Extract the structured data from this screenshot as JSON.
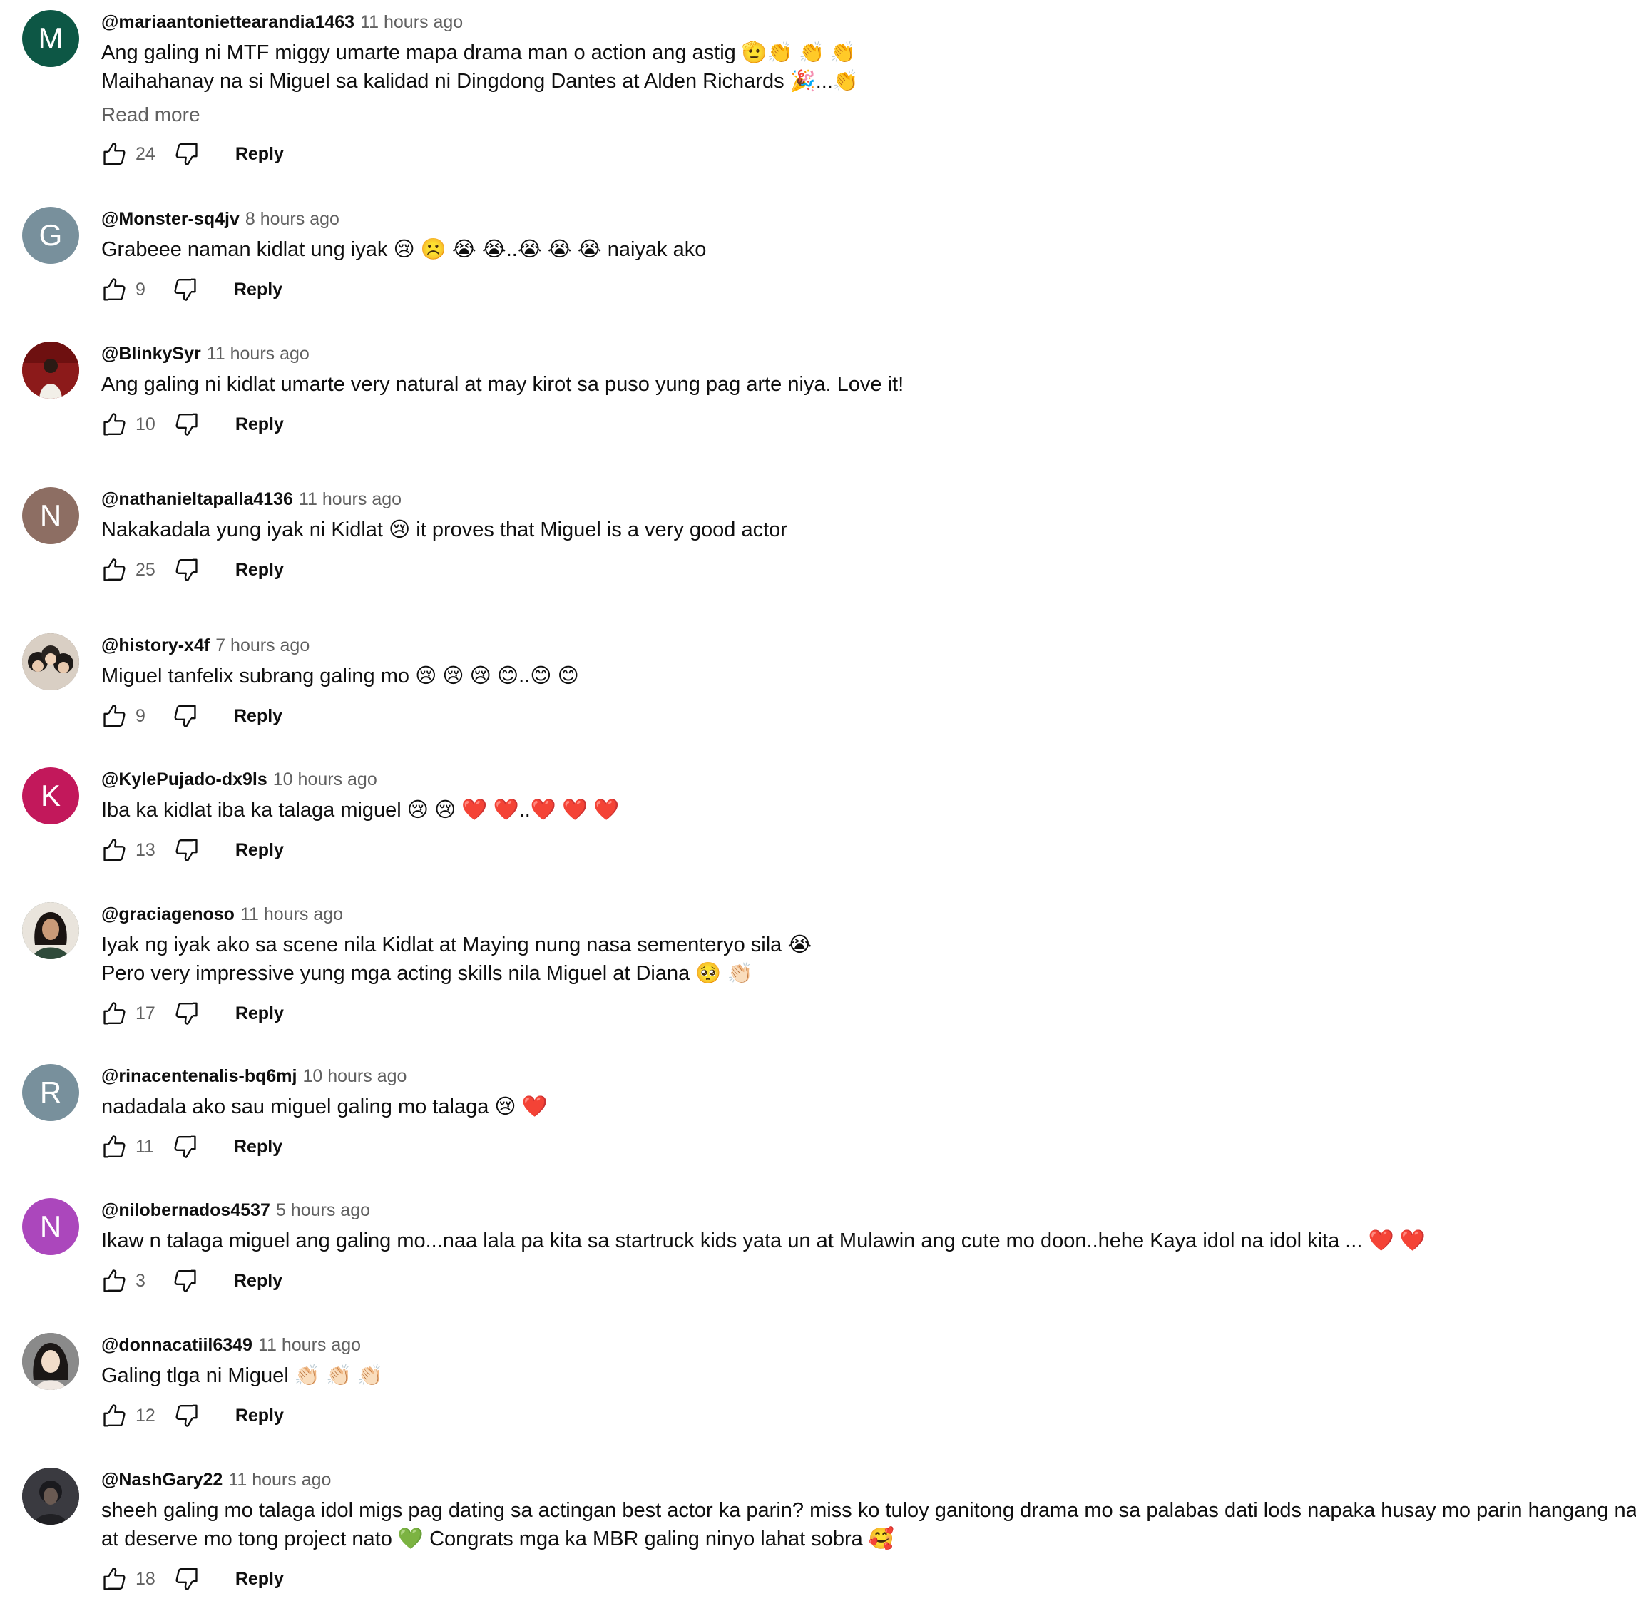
{
  "comments": [
    {
      "author": "@mariaantoniettearandia1463",
      "time": "11 hours ago",
      "lines": [
        "Ang galing ni MTF  miggy umarte mapa drama man o action ang astig 🫡👏 👏 👏",
        "Maihahanay na si Miguel sa kalidad ni Dingdong Dantes at Alden Richards 🎉...👏"
      ],
      "read_more": "Read more",
      "likes": "24",
      "reply": "Reply",
      "avatar": {
        "letter": "M",
        "color": "#0d5745"
      }
    },
    {
      "author": "@Monster-sq4jv",
      "time": "8 hours ago",
      "lines": [
        "Grabeee naman kidlat ung iyak 😢 ☹️ 😭 😭..😭 😭 😭 naiyak ako"
      ],
      "likes": "9",
      "reply": "Reply",
      "avatar": {
        "letter": "G",
        "color": "#78909c"
      }
    },
    {
      "author": "@BlinkySyr",
      "time": "11 hours ago",
      "lines": [
        "Ang galing ni kidlat umarte very natural at may kirot sa puso yung pag arte niya. Love it!"
      ],
      "likes": "10",
      "reply": "Reply",
      "avatar": {
        "letter": "",
        "color": "#8c1a1a"
      }
    },
    {
      "author": "@nathanieltapalla4136",
      "time": "11 hours ago",
      "lines": [
        "Nakakadala yung iyak ni Kidlat 😢  it proves that Miguel is a very good actor"
      ],
      "likes": "25",
      "reply": "Reply",
      "avatar": {
        "letter": "N",
        "color": "#8d6e63"
      }
    },
    {
      "author": "@history-x4f",
      "time": "7 hours ago",
      "lines": [
        "Miguel tanfelix subrang galing mo  😢 😢 😢 😊..😊 😊"
      ],
      "likes": "9",
      "reply": "Reply",
      "avatar": {
        "letter": "",
        "color": "#5a4a42"
      }
    },
    {
      "author": "@KylePujado-dx9ls",
      "time": "10 hours ago",
      "lines": [
        "Iba ka kidlat iba ka talaga miguel 😢 😢 ❤️ ❤️..❤️ ❤️ ❤️"
      ],
      "likes": "13",
      "reply": "Reply",
      "avatar": {
        "letter": "K",
        "color": "#c2185b"
      }
    },
    {
      "author": "@graciagenoso",
      "time": "11 hours ago",
      "lines": [
        "Iyak ng iyak ako sa scene nila Kidlat at Maying nung nasa sementeryo sila 😭",
        "Pero very impressive yung mga acting skills nila Miguel at Diana 🥺 👏🏻"
      ],
      "likes": "17",
      "reply": "Reply",
      "avatar": {
        "letter": "",
        "color": "#3a4a3f"
      }
    },
    {
      "author": "@rinacentenalis-bq6mj",
      "time": "10 hours ago",
      "lines": [
        "nadadala ako sau miguel galing mo talaga 😢 ❤️"
      ],
      "likes": "11",
      "reply": "Reply",
      "avatar": {
        "letter": "R",
        "color": "#78909c"
      }
    },
    {
      "author": "@nilobernados4537",
      "time": "5 hours ago",
      "lines": [
        "Ikaw n talaga miguel ang galing mo...naa lala pa kita sa startruck kids yata un at Mulawin ang cute mo doon..hehe Kaya idol na idol kita ... ❤️ ❤️"
      ],
      "likes": "3",
      "reply": "Reply",
      "avatar": {
        "letter": "N",
        "color": "#ab47bc"
      }
    },
    {
      "author": "@donnacatiil6349",
      "time": "11 hours ago",
      "lines": [
        "Galing tlga ni Miguel 👏🏻 👏🏻 👏🏻"
      ],
      "likes": "12",
      "reply": "Reply",
      "avatar": {
        "letter": "",
        "color": "#6b6b6b"
      }
    },
    {
      "author": "@NashGary22",
      "time": "11 hours ago",
      "lines": [
        "sheeh galing mo talaga idol migs pag dating sa actingan best actor ka parin? miss ko tuloy ganitong drama mo sa palabas dati lods napaka husay mo parin hangang nayon",
        "at deserve mo tong project nato 💚  Congrats mga ka MBR galing ninyo lahat sobra 🥰"
      ],
      "likes": "18",
      "reply": "Reply",
      "avatar": {
        "letter": "",
        "color": "#2b2b30"
      }
    }
  ],
  "icons": {
    "like": "thumbs-up-icon",
    "dislike": "thumbs-down-icon"
  }
}
